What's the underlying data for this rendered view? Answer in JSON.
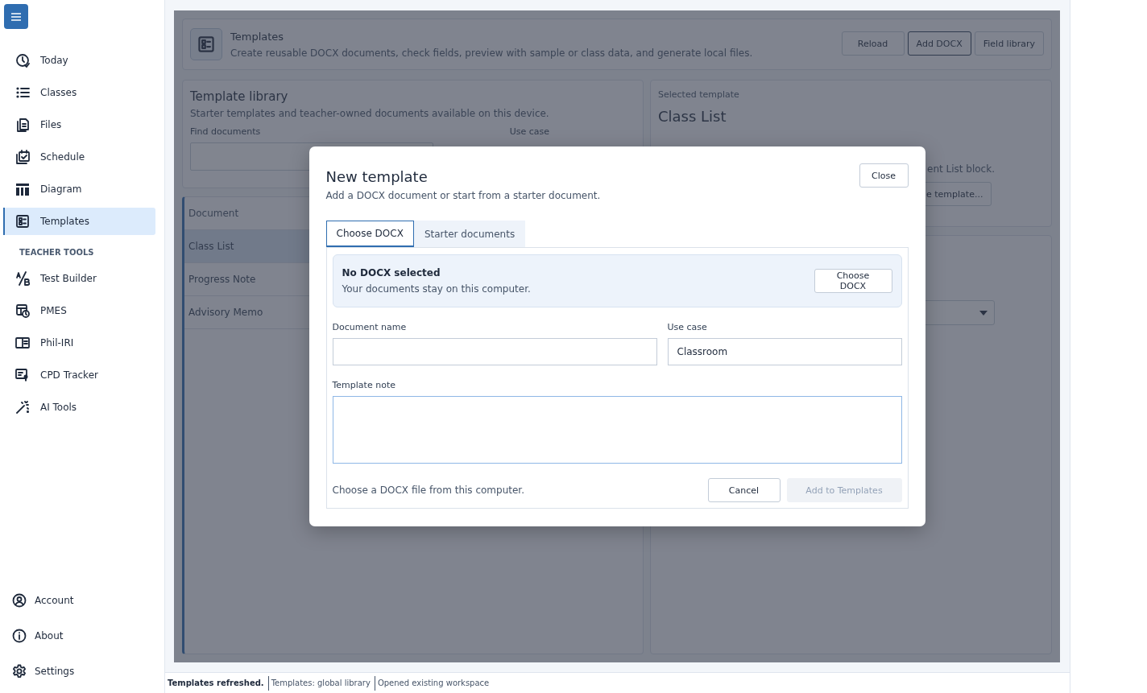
{
  "sidebar": {
    "items": [
      {
        "label": "Today",
        "selected": false
      },
      {
        "label": "Classes",
        "selected": false
      },
      {
        "label": "Files",
        "selected": false
      },
      {
        "label": "Schedule",
        "selected": false
      },
      {
        "label": "Diagram",
        "selected": false
      },
      {
        "label": "Templates",
        "selected": true
      }
    ],
    "section_heading": "TEACHER TOOLS",
    "tools": [
      {
        "label": "Test Builder",
        "selected": false
      },
      {
        "label": "PMES",
        "selected": false
      },
      {
        "label": "Phil-IRI",
        "selected": false
      },
      {
        "label": "CPD Tracker",
        "selected": false
      },
      {
        "label": "AI Tools",
        "selected": false
      }
    ],
    "footer": [
      {
        "label": "Account"
      },
      {
        "label": "About"
      },
      {
        "label": "Settings"
      }
    ]
  },
  "page_header": {
    "title": "Templates",
    "subtitle": "Create reusable DOCX documents, check fields, preview with sample or class data, and generate local files.",
    "buttons": [
      {
        "label": "Reload",
        "focused": false
      },
      {
        "label": "Add DOCX",
        "focused": true
      },
      {
        "label": "Field library",
        "focused": false
      }
    ]
  },
  "library": {
    "title": "Template library",
    "subtitle": "Starter templates and teacher-owned documents available on this device.",
    "search_label": "Find documents",
    "use_case_label": "Use case",
    "list_header": "Document",
    "rows": [
      {
        "label": "Class List",
        "selected": true
      },
      {
        "label": "Progress Note",
        "selected": false
      },
      {
        "label": "Advisory Memo",
        "selected": false
      }
    ]
  },
  "selected_template": {
    "caption": "Selected template",
    "title": "Class List",
    "note_fragment": "ent List block.",
    "button_fragment": "e template..."
  },
  "dialog": {
    "title": "New template",
    "subtitle": "Add a DOCX document or start from a starter document.",
    "close_button": "Close",
    "tabs": [
      {
        "label": "Choose DOCX",
        "selected": true
      },
      {
        "label": "Starter documents",
        "selected": false
      }
    ],
    "file_box": {
      "title": "No DOCX selected",
      "note": "Your documents stay on this computer.",
      "button": "Choose DOCX"
    },
    "document_name": {
      "label": "Document name"
    },
    "use_case": {
      "label": "Use case",
      "value": "Classroom"
    },
    "template_note": {
      "label": "Template note",
      "focused": true
    },
    "hint": "Choose a DOCX file from this computer.",
    "buttons": [
      {
        "label": "Cancel",
        "disabled": false
      },
      {
        "label": "Add to Templates",
        "disabled": true
      }
    ]
  },
  "status_bar": [
    {
      "text": "Templates refreshed.",
      "kind": "message"
    },
    {
      "text": "Templates: global library",
      "kind": "info"
    },
    {
      "text": "Opened existing workspace",
      "kind": "info"
    }
  ]
}
